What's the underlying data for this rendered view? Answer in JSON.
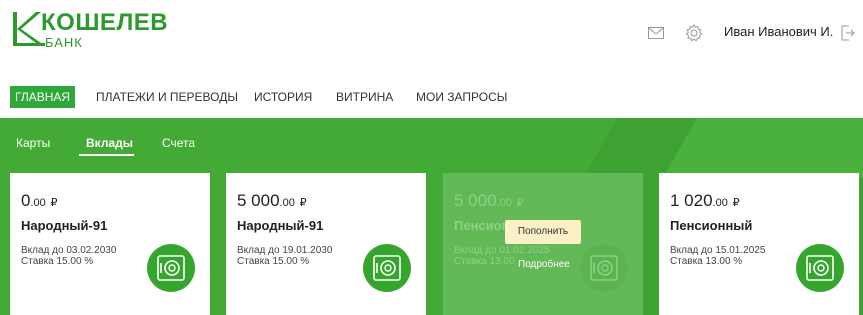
{
  "brand": {
    "name": "КОШЕЛЕВ",
    "sub": "БАНК",
    "color": "#2c9a2c"
  },
  "header": {
    "user_name": "Иван Иванович И.",
    "icons": [
      "mail-icon",
      "gear-icon",
      "logout-icon"
    ]
  },
  "nav": {
    "items": [
      {
        "label": "ГЛАВНАЯ",
        "active": true
      },
      {
        "label": "ПЛАТЕЖИ И ПЕРЕВОДЫ",
        "active": false
      },
      {
        "label": "ИСТОРИЯ",
        "active": false
      },
      {
        "label": "ВИТРИНА",
        "active": false
      },
      {
        "label": "МОИ ЗАПРОСЫ",
        "active": false
      }
    ]
  },
  "subtabs": [
    {
      "label": "Карты",
      "active": false
    },
    {
      "label": "Вклады",
      "active": true
    },
    {
      "label": "Счета",
      "active": false
    }
  ],
  "deposits": [
    {
      "amount_int": "0",
      "amount_dec": ".00",
      "currency": "₽",
      "name": "Народный-91",
      "until": "Вклад до 03.02.2030",
      "rate": "Ставка 15.00 %"
    },
    {
      "amount_int": "5 000",
      "amount_dec": ".00",
      "currency": "₽",
      "name": "Народный-91",
      "until": "Вклад до 19.01.2030",
      "rate": "Ставка 15.00 %"
    },
    {
      "amount_int": "5 000",
      "amount_dec": ".00",
      "currency": "₽",
      "name": "Пенсион",
      "until": "Вклад до 01.02.2025",
      "rate": "Ставка 13.00",
      "hovered": true
    },
    {
      "amount_int": "1 020",
      "amount_dec": ".00",
      "currency": "₽",
      "name": "Пенсионный",
      "until": "Вклад до 15.01.2025",
      "rate": "Ставка 13.00 %"
    }
  ],
  "hover_actions": {
    "topup_label": "Пополнить",
    "more_label": "Подробнее"
  },
  "colors": {
    "green_band": "#43aa36",
    "nav_active": "#2fa83a",
    "topup_bg": "#fbf0c6"
  }
}
